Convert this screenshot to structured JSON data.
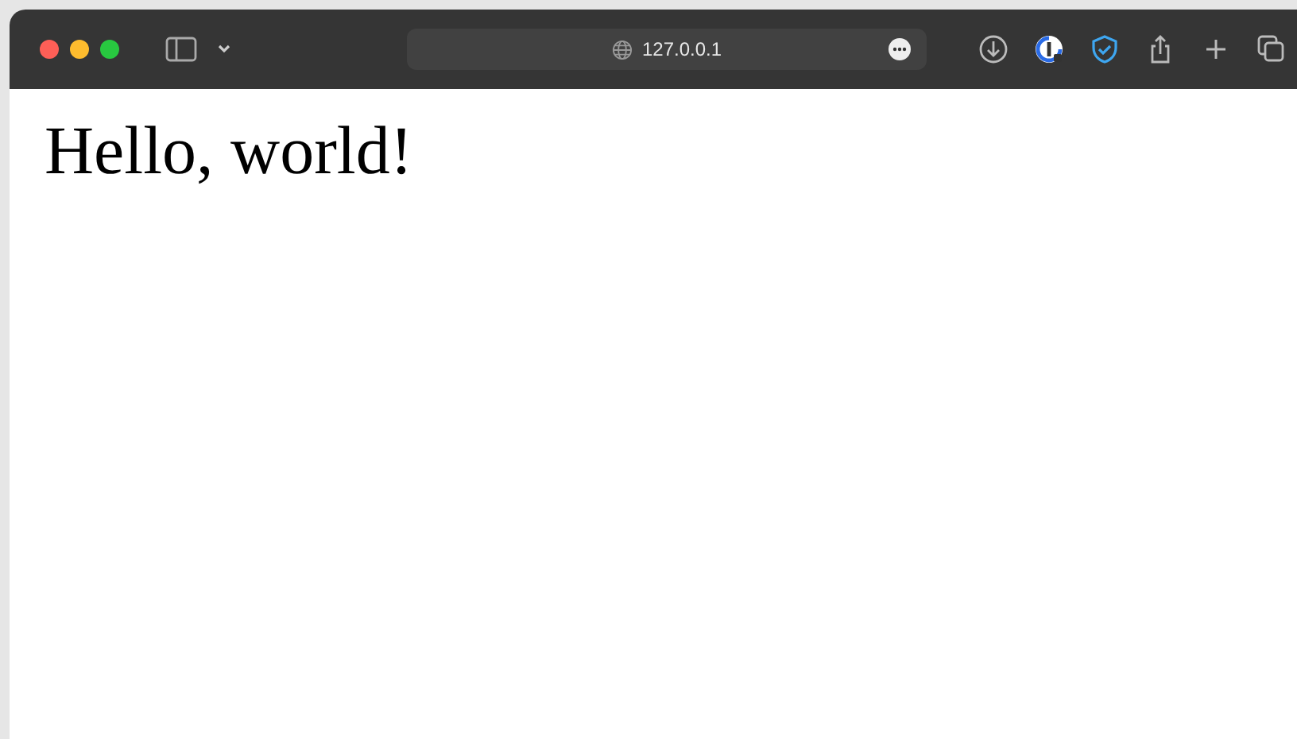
{
  "address_bar": {
    "url": "127.0.0.1"
  },
  "page": {
    "heading": "Hello, world!"
  }
}
